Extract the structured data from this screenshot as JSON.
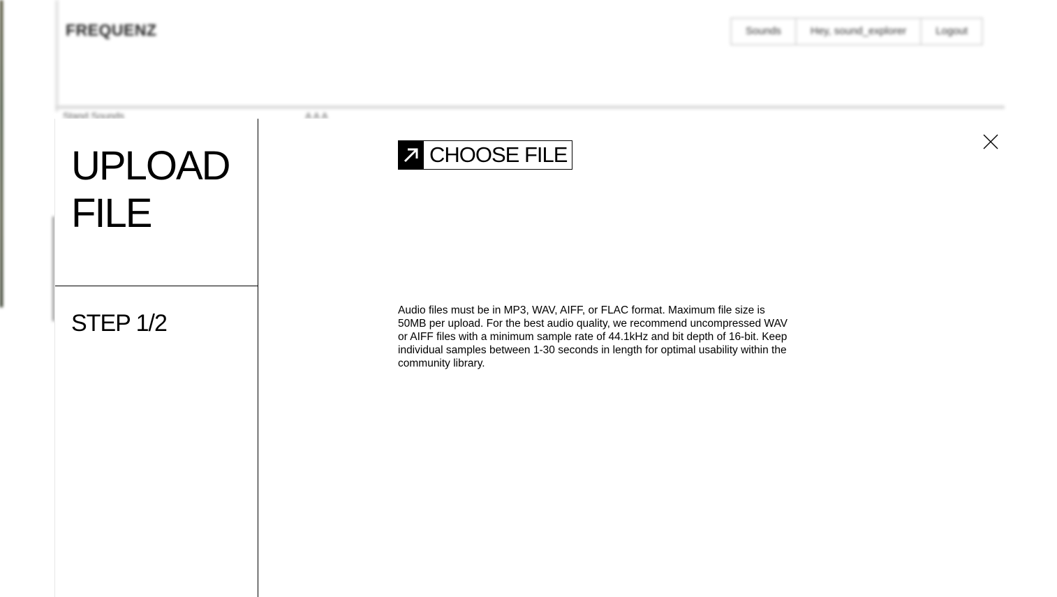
{
  "background": {
    "logo": "FREQUENZ",
    "nav": [
      "Sounds",
      "Hey, sound_explorer",
      "Logout"
    ],
    "subtext_left": "Stand Sounds",
    "subtext_mid": "A A A"
  },
  "modal": {
    "title": "UPLOAD FILE",
    "step": "STEP 1/2",
    "choose_file_label": "CHOOSE FILE",
    "choose_file_icon": "arrow-up-right-icon",
    "info_text": "Audio files must be in MP3, WAV, AIFF, or FLAC format. Maximum file size is 50MB per upload. For the best audio quality, we recommend uncompressed WAV or AIFF files with a minimum sample rate of 44.1kHz and bit depth of 16-bit. Keep individual samples between 1-30 seconds in length for optimal usability within the community library.",
    "close_icon": "close-icon"
  }
}
